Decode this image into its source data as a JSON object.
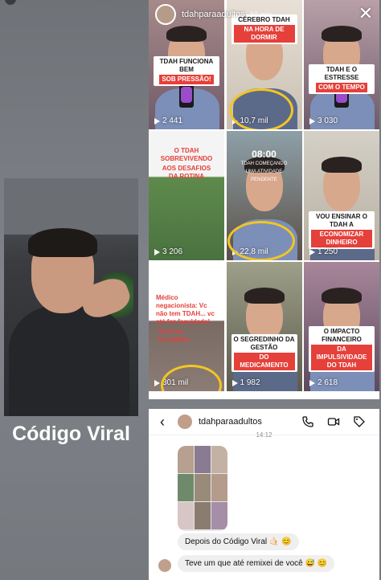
{
  "story": {
    "title": "Código Viral"
  },
  "profile_grid": {
    "username": "tdahparaadultos",
    "time": "10 min",
    "posts": [
      {
        "caption": "TDAH FUNCIONA BEM",
        "caption_hl": "SOB PRESSÃO!",
        "views": "2 441",
        "highlighted": false
      },
      {
        "caption": "CÉREBRO TDAH",
        "caption_hl": "NA HORA DE DORMIR",
        "views": "10,7 mil",
        "highlighted": true
      },
      {
        "caption": "TDAH E O ESTRESSE",
        "caption_hl": "COM O TEMPO",
        "views": "3 030",
        "highlighted": false
      },
      {
        "caption": "O TDAH SOBREVIVENDO",
        "caption_hl": "AOS DESAFIOS DA ROTINA",
        "views": "3 206",
        "highlighted": false
      },
      {
        "caption": "08:00",
        "caption_hl": "TDAH COMEÇANDO UMA ATIVIDADE PENDENTE",
        "views": "22,8 mil",
        "highlighted": true
      },
      {
        "caption": "VOU ENSINAR O TDAH A",
        "caption_hl": "ECONOMIZAR DINHEIRO",
        "views": "1 250",
        "highlighted": false
      },
      {
        "caption": "Médico negacionista: Vc não tem TDAH... vc até fez faculdade!",
        "caption_hl": "Você na faculdade:",
        "views": "301 mil",
        "highlighted": true
      },
      {
        "caption": "O SEGREDINHO DA GESTÃO",
        "caption_hl": "DO MEDICAMENTO",
        "views": "1 982",
        "highlighted": false
      },
      {
        "caption": "O IMPACTO FINANCEIRO",
        "caption_hl": "DA IMPULSIVIDADE DO TDAH",
        "views": "2 618",
        "highlighted": false
      }
    ]
  },
  "dm": {
    "username": "tdahparaadultos",
    "timestamp": "14:12",
    "messages": [
      {
        "text": "Depois do Código Viral 🤙🏻 😊"
      },
      {
        "text": "Teve um que até remixei de você 😅 😊"
      }
    ]
  }
}
